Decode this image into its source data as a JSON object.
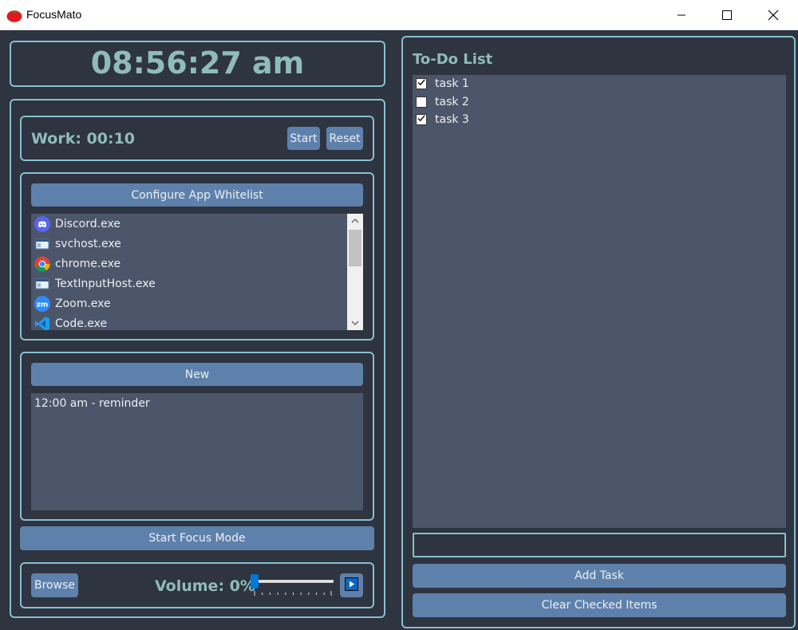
{
  "window": {
    "title": "FocusMato",
    "app_icon": "tomato-icon"
  },
  "clock": {
    "time": "08:56:27 am"
  },
  "timer": {
    "label": "Work: 00:10",
    "start_label": "Start",
    "reset_label": "Reset"
  },
  "whitelist": {
    "configure_label": "Configure App Whitelist",
    "apps": [
      {
        "name": "Discord.exe",
        "icon": "discord-icon"
      },
      {
        "name": "svchost.exe",
        "icon": "window-icon"
      },
      {
        "name": "chrome.exe",
        "icon": "chrome-icon"
      },
      {
        "name": "TextInputHost.exe",
        "icon": "window-icon"
      },
      {
        "name": "Zoom.exe",
        "icon": "zoom-icon"
      },
      {
        "name": "Code.exe",
        "icon": "vscode-icon"
      }
    ]
  },
  "reminders": {
    "new_label": "New",
    "items": [
      "12:00 am - reminder"
    ]
  },
  "focus": {
    "start_label": "Start Focus Mode"
  },
  "audio": {
    "browse_label": "Browse",
    "volume_label": "Volume: 0%",
    "volume": 0
  },
  "todo": {
    "title": "To-Do List",
    "tasks": [
      {
        "label": "task 1",
        "checked": true
      },
      {
        "label": "task 2",
        "checked": false
      },
      {
        "label": "task 3",
        "checked": true
      }
    ],
    "input_value": "",
    "add_label": "Add Task",
    "clear_label": "Clear Checked Items"
  },
  "colors": {
    "accent": "#88c0d0",
    "button": "#5e81ac",
    "background": "#2e3440",
    "list": "#4c566a"
  }
}
